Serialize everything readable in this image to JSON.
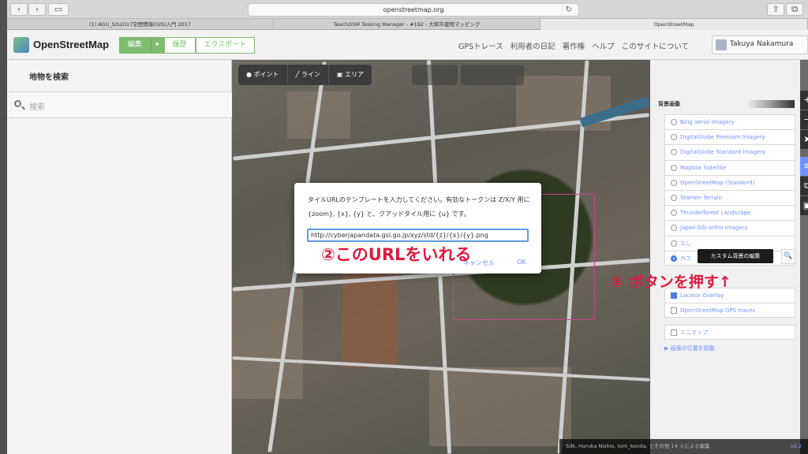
{
  "browser": {
    "url": "openstreetmap.org",
    "tabs": [
      "(1) AGU_SIS2017空間情報(GIS)入門 2017",
      "TeachOSM Tasking Manager - #192 - 大和市建物マッピング",
      "OpenStreetMap"
    ]
  },
  "header": {
    "brand": "OpenStreetMap",
    "edit_label": "編集",
    "history_label": "履歴",
    "export_label": "エクスポート",
    "nav": [
      "GPSトレース",
      "利用者の日記",
      "著作権",
      "ヘルプ",
      "このサイトについて"
    ],
    "user": "Takuya Nakamura"
  },
  "sidebar": {
    "title": "地物を検索",
    "search_placeholder": "検索"
  },
  "editor": {
    "point": "ポイント",
    "line": "ライン",
    "area": "エリア"
  },
  "dialog": {
    "message": "タイルURLのテンプレートを入力してください。有効なトークンは Z/X/Y 用に {zoom}, {x}, {y} と、クアッドタイル用に {u} です。",
    "url_value": "http://cyberjapandata.gsi.go.jp/xyz/std/{z}/{x}/{y}.png",
    "cancel": "キャンセル",
    "ok": "OK"
  },
  "background": {
    "title": "背景画像",
    "sources": [
      "Bing aerial imagery",
      "DigitalGlobe Premium Imagery",
      "DigitalGlobe Standard Imagery",
      "Mapbox Satellite",
      "OpenStreetMap (Standard)",
      "Stamen Terrain",
      "Thunderforest Landscape",
      "Japan GSI ortho Imagery",
      "なし",
      "カス"
    ],
    "selected_index": 9,
    "custom_tooltip": "カスタム背景の編集",
    "overlays": [
      "Locator Overlay",
      "OpenStreetMap GPS traces"
    ],
    "overlays_checked": [
      true,
      false
    ],
    "minimap": "ミニマップ",
    "adjust": "▶ 画像の位置を調整"
  },
  "annotations": {
    "step1": "① ボタンを押す↑",
    "step2": "②このURLをいれる"
  },
  "footer": {
    "text": "Sdk, Haruka Nishio, tom_konda, とその他 14 人による編集",
    "version": "v2.2"
  }
}
